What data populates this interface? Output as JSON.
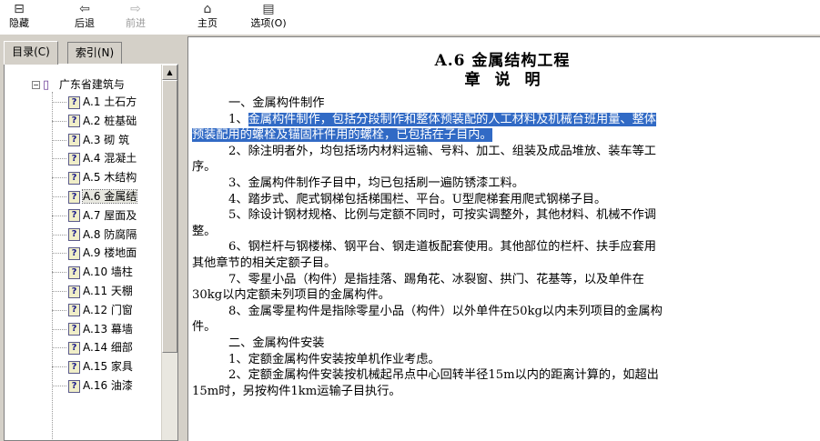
{
  "toolbar": {
    "buttons": [
      {
        "label": "隐藏",
        "icon": "hide-pane-icon",
        "glyph": "⊟",
        "disabled": false
      },
      {
        "label": "后退",
        "icon": "back-arrow-icon",
        "glyph": "⇦",
        "disabled": false
      },
      {
        "label": "前进",
        "icon": "forward-arrow-icon",
        "glyph": "⇨",
        "disabled": true
      },
      {
        "label": "主页",
        "icon": "home-icon",
        "glyph": "⌂",
        "disabled": false
      },
      {
        "label": "选项(O)",
        "icon": "options-icon",
        "glyph": "▤",
        "disabled": false
      }
    ]
  },
  "nav": {
    "tabs": [
      {
        "label": "目录(C)",
        "active": true
      },
      {
        "label": "索引(N)",
        "active": false
      }
    ],
    "tree": {
      "root_label": "广东省建筑与",
      "items": [
        {
          "label": "A.1 土石方"
        },
        {
          "label": "A.2 桩基础"
        },
        {
          "label": "A.3 砌 筑"
        },
        {
          "label": "A.4 混凝土"
        },
        {
          "label": "A.5 木结构"
        },
        {
          "label": "A.6 金属结"
        },
        {
          "label": "A.7 屋面及"
        },
        {
          "label": "A.8 防腐隔"
        },
        {
          "label": "A.9 楼地面"
        },
        {
          "label": "A.10 墙柱"
        },
        {
          "label": "A.11 天棚"
        },
        {
          "label": "A.12 门窗"
        },
        {
          "label": "A.13 幕墙"
        },
        {
          "label": "A.14 细部"
        },
        {
          "label": "A.15 家具"
        },
        {
          "label": "A.16 油漆"
        }
      ],
      "selected_index": 5
    }
  },
  "document": {
    "title": "A.6 金属结构工程",
    "subtitle": [
      "章",
      "说",
      "明"
    ],
    "section1_heading": "一、金属构件制作",
    "p1_prefix": "1、",
    "p1_highlight_a": "金属构件制作，包括分段制作和整体预装配的人工材料及机械台班用量、整体",
    "p1_highlight_b": "预装配用的螺栓及锚固杆件用的螺栓，已包括在子目内。",
    "p2_a": "2、除注明者外，均包括场内材料运输、号料、加工、组装及成品堆放、装车等工",
    "p2_b": "序。",
    "p3": "3、金属构件制作子目中，均已包括刷一遍防锈漆工料。",
    "p4": "4、踏步式、爬式钢梯包括梯围栏、平台。U型爬梯套用爬式钢梯子目。",
    "p5_a": "5、除设计钢材规格、比例与定额不同时，可按实调整外，其他材料、机械不作调",
    "p5_b": "整。",
    "p6_a": "6、钢栏杆与钢楼梯、钢平台、钢走道板配套使用。其他部位的栏杆、扶手应套用",
    "p6_b": "其他章节的相关定额子目。",
    "p7_a": "7、零星小品（构件）是指挂落、踢角花、冰裂窗、拱门、花基等，以及单件在",
    "p7_b": "30kg以内定额未列项目的金属构件。",
    "p8_a": "8、金属零星构件是指除零星小品（构件）以外单件在50kg以内未列项目的金属构",
    "p8_b": "件。",
    "section2_heading": "二、金属构件安装",
    "s2p1": "1、定额金属构件安装按单机作业考虑。",
    "s2p2_a": "2、定额金属构件安装按机械起吊点中心回转半径15m以内的距离计算的，如超出",
    "s2p2_b": "15m时，另按构件1km运输子目执行。"
  },
  "colors": {
    "highlight": "#316ac5",
    "chrome": "#d4d0c8"
  }
}
